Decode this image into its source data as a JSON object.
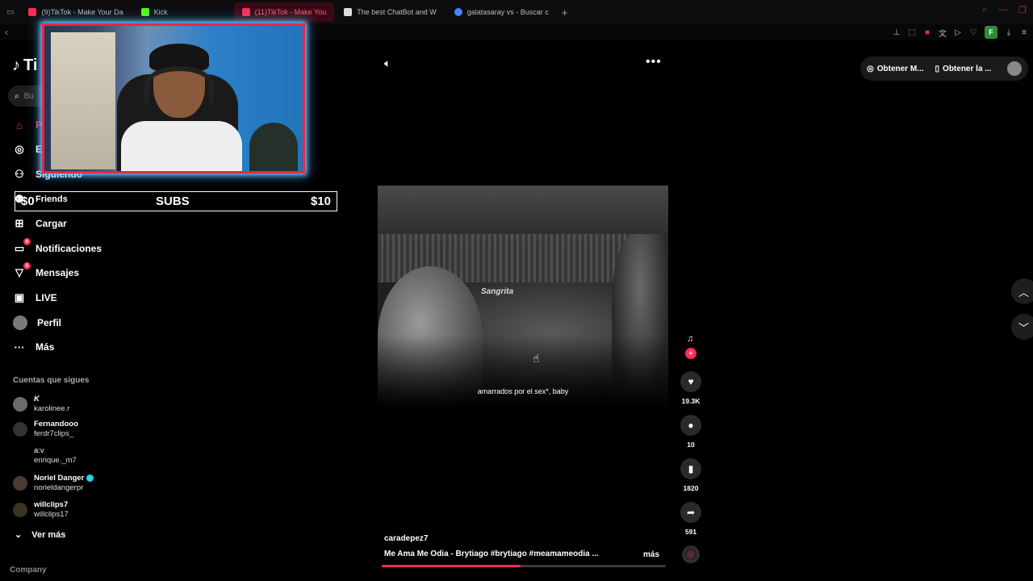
{
  "browser": {
    "tabs": [
      {
        "label": "(9)TikTok - Make Your Da",
        "color": "#ff2c55"
      },
      {
        "label": "Kick",
        "color": "#53fc18"
      },
      {
        "label": "(11)TikTok - Make You",
        "color": "#ff2c55",
        "active": true
      },
      {
        "label": "The best ChatBot and W",
        "color": "#dddddd"
      },
      {
        "label": "galatasaray vs - Buscar c",
        "color": "#4285f4"
      }
    ],
    "new_tab": "+",
    "ext_f": "F"
  },
  "sidebar": {
    "logo": "Ti",
    "search_placeholder": "Bu",
    "items": [
      {
        "label": "Pa",
        "icon": "home-icon",
        "badge": ""
      },
      {
        "label": "Ex",
        "icon": "compass-icon",
        "badge": ""
      },
      {
        "label": "Siguiendo",
        "icon": "following-icon",
        "badge": ""
      },
      {
        "label": "Friends",
        "icon": "friends-icon",
        "badge": ""
      },
      {
        "label": "Cargar",
        "icon": "upload-icon",
        "badge": ""
      },
      {
        "label": "Notificaciones",
        "icon": "notifications-icon",
        "badge": "6"
      },
      {
        "label": "Mensajes",
        "icon": "messages-icon",
        "badge": "5"
      },
      {
        "label": "LIVE",
        "icon": "live-icon",
        "badge": ""
      },
      {
        "label": "Perfil",
        "icon": "profile-avatar",
        "badge": ""
      },
      {
        "label": "Más",
        "icon": "more-dots-icon",
        "badge": ""
      }
    ],
    "following_title": "Cuentas que sigues",
    "following": [
      {
        "display": "K",
        "username": "karolinee.r",
        "verified": false
      },
      {
        "display": "Fernandooo",
        "username": "ferdr7clips_",
        "verified": false
      },
      {
        "display": "a:v",
        "username": "enrique._m7",
        "verified": false
      },
      {
        "display": "Noriel Danger",
        "username": "norieldangerpr",
        "verified": true
      },
      {
        "display": "willclips7",
        "username": "willclips17",
        "verified": false
      }
    ],
    "see_more": "Ver más",
    "company": "Company"
  },
  "overlay": {
    "subs_left": "$0",
    "subs_center": "SUBS",
    "subs_right": "$10"
  },
  "video": {
    "caption": "amarrados por el sex*, baby",
    "sign": "Sangrita",
    "author": "caradepez7",
    "description": "Me Ama Me Odia - Brytiago #brytiago  #meamameodia  ...",
    "more": "más",
    "progress": 0.49,
    "likes": "19.3K",
    "comments": "10",
    "saves": "1820",
    "shares": "591"
  },
  "top_right": {
    "item1": "Obtener M...",
    "item2": "Obtener la ..."
  },
  "colors": {
    "accent": "#fe2c55",
    "background": "#000000"
  }
}
